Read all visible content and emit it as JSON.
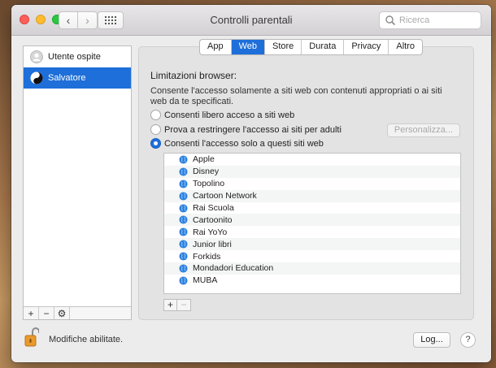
{
  "window": {
    "title": "Controlli parentali"
  },
  "search": {
    "placeholder": "Ricerca"
  },
  "sidebar": {
    "users": [
      {
        "name": "Utente ospite",
        "selected": false
      },
      {
        "name": "Salvatore",
        "selected": true
      }
    ],
    "bar": {
      "add": "+",
      "remove": "−"
    }
  },
  "tabs": [
    {
      "label": "App",
      "active": false
    },
    {
      "label": "Web",
      "active": true
    },
    {
      "label": "Store",
      "active": false
    },
    {
      "label": "Durata",
      "active": false
    },
    {
      "label": "Privacy",
      "active": false
    },
    {
      "label": "Altro",
      "active": false
    }
  ],
  "web": {
    "section_title": "Limitazioni browser:",
    "description": "Consente l'accesso solamente a siti web con contenuti appropriati o ai siti web da te specificati.",
    "options": [
      {
        "label": "Consenti libero acceso a siti web",
        "selected": false
      },
      {
        "label": "Prova a restringere l'accesso ai siti per adulti",
        "selected": false
      },
      {
        "label": "Consenti l'accesso solo a questi siti web",
        "selected": true
      }
    ],
    "customize_label": "Personalizza...",
    "sites": [
      "Apple",
      "Disney",
      "Topolino",
      "Cartoon Network",
      "Rai Scuola",
      "Cartoonito",
      "Rai YoYo",
      "Junior libri",
      "Forkids",
      "Mondadori Education",
      "MUBA"
    ],
    "list_add": "+",
    "list_remove": "−"
  },
  "footer": {
    "lock_label": "Modifiche abilitate.",
    "log_label": "Log...",
    "help_label": "?"
  },
  "colors": {
    "accent": "#1e6fd9"
  }
}
